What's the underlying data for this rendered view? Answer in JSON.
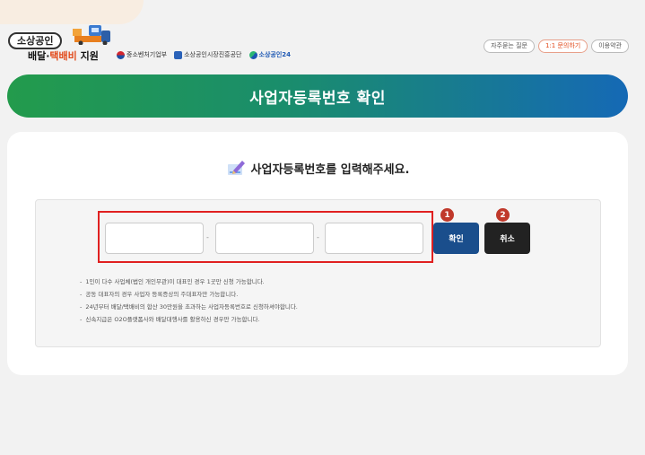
{
  "header": {
    "logo_pill": "소상공인",
    "logo_sub_prefix": "배달·",
    "logo_sub_em": "택배비",
    "logo_sub_suffix": " 지원",
    "agencies": [
      "중소벤처기업부",
      "소상공인시장진흥공단",
      "소상공인24"
    ],
    "links": [
      "자주묻는 질문",
      "1:1 문의하기",
      "이용약관"
    ]
  },
  "banner": {
    "title": "사업자등록번호 확인"
  },
  "form": {
    "prompt": "사업자등록번호를 입력해주세요.",
    "separator": "-",
    "confirm_label": "확인",
    "cancel_label": "취소",
    "badges": [
      "1",
      "2"
    ],
    "notes": [
      "1인이 다수 사업체(법인 개인무관)이 대표인 경우 1곳만 신청 가능합니다.",
      "공동 대표자의 경우 사업자 등록증상의 주대표자만 가능합니다.",
      "24년부터 배달/택배비의 합산 30만원을 초과하는 사업자등록번호로 신청하셔야합니다.",
      "신속지급은 O2O플랫폼사와 배달대행사를 활용하신 경우만 가능합니다."
    ]
  },
  "colors": {
    "banner_start": "#239b4c",
    "banner_end": "#1569b5",
    "confirm": "#1a4e8c",
    "cancel": "#222222",
    "highlight": "#e02020",
    "badge": "#c0392b"
  }
}
